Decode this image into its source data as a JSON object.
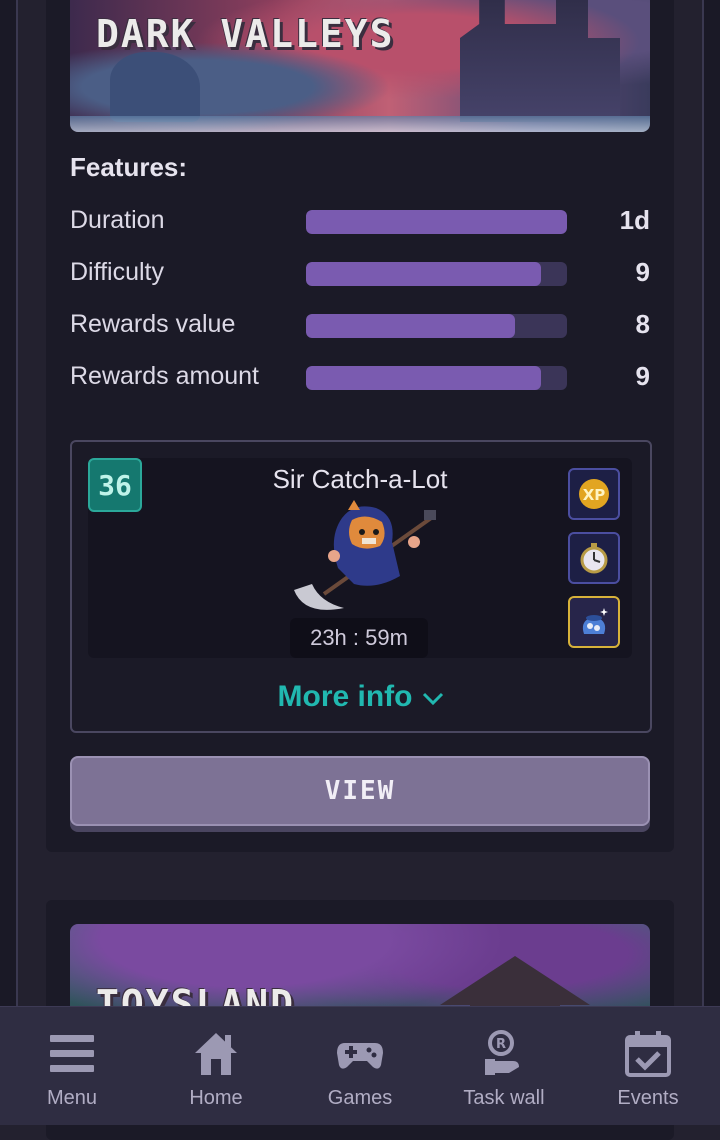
{
  "card1": {
    "banner_title": "DARK VALLEYS",
    "features_title": "Features:",
    "features": [
      {
        "label": "Duration",
        "value": "1d",
        "level": 1.0
      },
      {
        "label": "Difficulty",
        "value": "9",
        "level": 0.9
      },
      {
        "label": "Rewards value",
        "value": "8",
        "level": 0.8
      },
      {
        "label": "Rewards amount",
        "value": "9",
        "level": 0.9
      }
    ],
    "character": {
      "level": "36",
      "name": "Sir Catch-a-Lot",
      "timer": "23h : 59m",
      "perks": [
        {
          "icon": "xp-boost-icon",
          "selected": false
        },
        {
          "icon": "stopwatch-icon",
          "selected": false
        },
        {
          "icon": "treasure-sack-icon",
          "selected": true
        }
      ]
    },
    "more_info_label": "More info",
    "view_label": "VIEW"
  },
  "card2": {
    "banner_title": "TOYSLAND"
  },
  "nav": {
    "items": [
      {
        "label": "Menu",
        "icon": "menu-icon"
      },
      {
        "label": "Home",
        "icon": "home-icon"
      },
      {
        "label": "Games",
        "icon": "gamepad-icon"
      },
      {
        "label": "Task wall",
        "icon": "task-wall-icon"
      },
      {
        "label": "Events",
        "icon": "calendar-icon"
      }
    ]
  },
  "colors": {
    "accent": "#21b8b0",
    "bar_fill": "#7a5bb0",
    "bar_track": "#3b3558",
    "level_badge": "#15786f"
  }
}
